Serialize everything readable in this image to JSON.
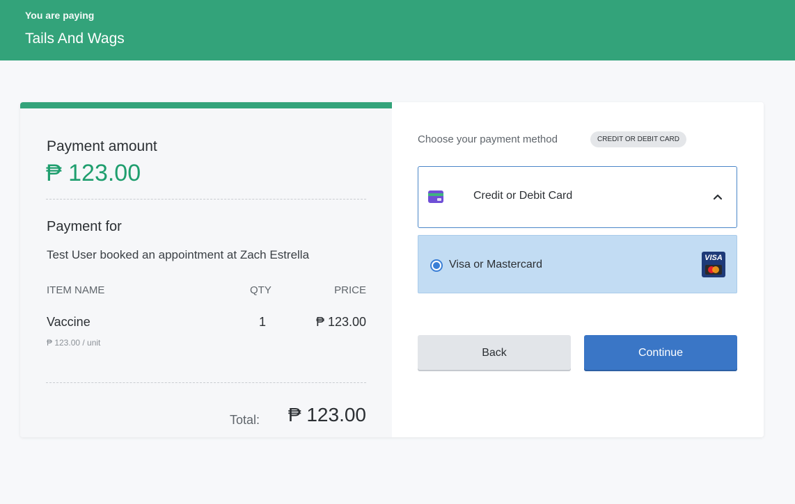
{
  "colors": {
    "brand": "#33a37a",
    "amount": "#1f9e6e",
    "selected_option": "#c2dcf3",
    "primary_button": "#3a76c6"
  },
  "header": {
    "subtitle": "You are paying",
    "merchant": "Tails And Wags"
  },
  "summary": {
    "amount_label": "Payment amount",
    "amount": "₱ 123.00",
    "payment_for_label": "Payment for",
    "description": "Test User booked an appointment at Zach Estrella",
    "table": {
      "headers": [
        "ITEM NAME",
        "QTY",
        "PRICE"
      ],
      "rows": [
        {
          "name": "Vaccine",
          "qty": "1",
          "price": "₱ 123.00",
          "unit_price": "₱ 123.00 / unit"
        }
      ]
    },
    "total_label": "Total:",
    "total_value": "₱ 123.00"
  },
  "payment": {
    "choose_label": "Choose your payment method",
    "badge": "CREDIT OR DEBIT CARD",
    "method": {
      "label": "Credit or Debit Card",
      "icon": "card-icon",
      "expanded": true
    },
    "option": {
      "label": "Visa or Mastercard",
      "selected": true,
      "icon": "visa-mastercard-icon",
      "visa_text": "VISA"
    },
    "back_label": "Back",
    "continue_label": "Continue"
  }
}
